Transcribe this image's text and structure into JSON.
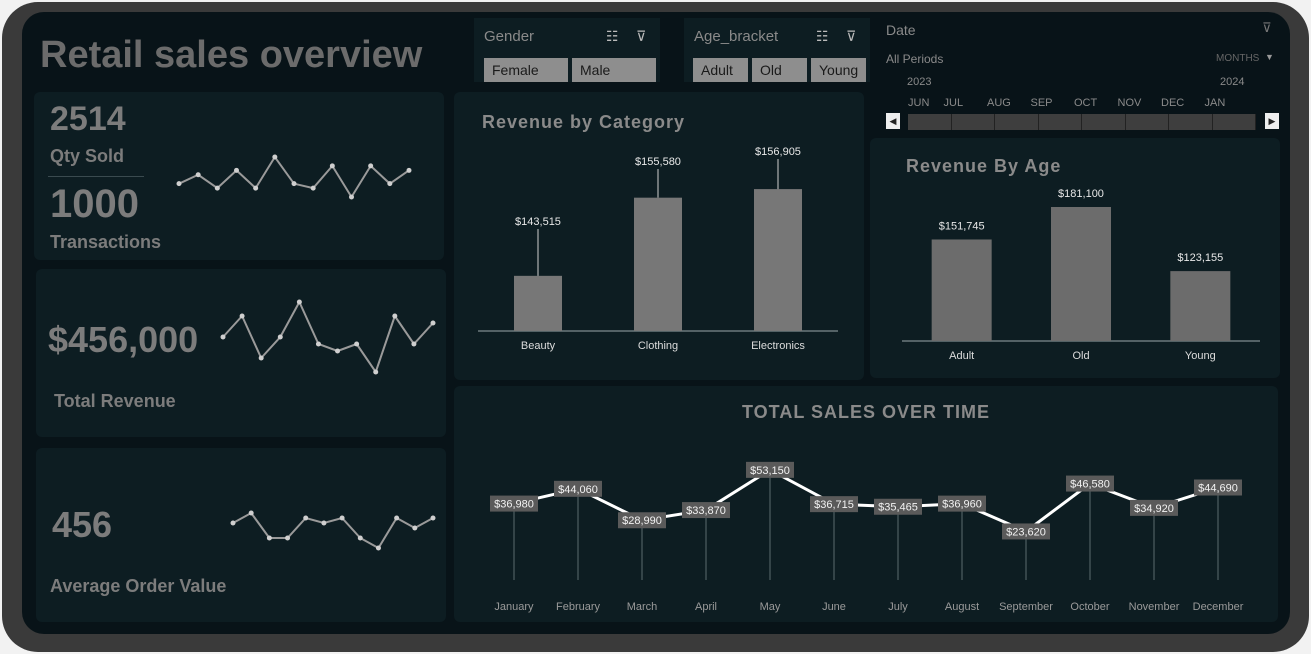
{
  "dashboard": {
    "title": "Retail sales overview"
  },
  "kpis": {
    "qty_sold_value": "2514",
    "qty_sold_label": "Qty Sold",
    "transactions_value": "1000",
    "transactions_label": "Transactions",
    "total_revenue_value": "$456,000",
    "total_revenue_label": "Total Revenue",
    "aov_value": "456",
    "aov_label": "Average Order Value"
  },
  "slicers": {
    "gender": {
      "title": "Gender",
      "options": [
        "Female",
        "Male"
      ]
    },
    "age": {
      "title": "Age_bracket",
      "options": [
        "Adult",
        "Old",
        "Young"
      ]
    }
  },
  "timeline": {
    "title": "Date",
    "periods_label": "All Periods",
    "unit_label": "MONTHS",
    "year_start": "2023",
    "year_end": "2024",
    "months": [
      "JUN",
      "JUL",
      "AUG",
      "SEP",
      "OCT",
      "NOV",
      "DEC",
      "JAN"
    ]
  },
  "chart_data": [
    {
      "type": "bar",
      "title": "Revenue by Category",
      "categories": [
        "Beauty",
        "Clothing",
        "Electronics"
      ],
      "values": [
        143515,
        155580,
        156905
      ],
      "data_labels": [
        "$143,515",
        "$155,580",
        "$156,905"
      ],
      "colors": {
        "bar": "#7a7a7a"
      }
    },
    {
      "type": "bar",
      "title": "Revenue By Age",
      "categories": [
        "Adult",
        "Old",
        "Young"
      ],
      "values": [
        151745,
        181100,
        123155
      ],
      "data_labels": [
        "$151,745",
        "$181,100",
        "$123,155"
      ],
      "colors": {
        "bar": "#6e6e6e"
      }
    },
    {
      "type": "line",
      "title": "TOTAL SALES OVER TIME",
      "categories": [
        "January",
        "February",
        "March",
        "April",
        "May",
        "June",
        "July",
        "August",
        "September",
        "October",
        "November",
        "December"
      ],
      "values": [
        36980,
        44060,
        28990,
        33870,
        53150,
        36715,
        35465,
        36960,
        23620,
        46580,
        34920,
        44690
      ],
      "data_labels": [
        "$36,980",
        "$44,060",
        "$28,990",
        "$33,870",
        "$53,150",
        "$36,715",
        "$35,465",
        "$36,960",
        "$23,620",
        "$46,580",
        "$34,920",
        "$44,690"
      ],
      "colors": {
        "line": "#ffffff",
        "label_bg": "#5a5a5a"
      }
    }
  ],
  "sparklines": {
    "qty": [
      3,
      5,
      2,
      6,
      2,
      9,
      3,
      2,
      7,
      0,
      7,
      3,
      6
    ],
    "revenue": [
      5,
      8,
      2,
      5,
      10,
      4,
      3,
      4,
      0,
      8,
      4,
      7
    ],
    "aov": [
      6,
      8,
      3,
      3,
      7,
      6,
      7,
      3,
      1,
      7,
      5,
      7
    ]
  }
}
